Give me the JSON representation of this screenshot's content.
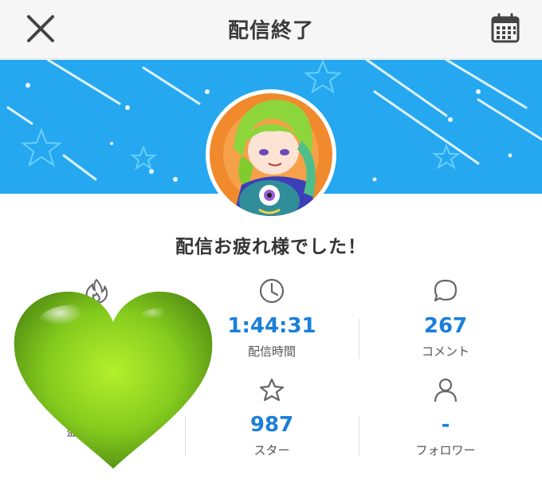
{
  "header": {
    "title": "配信終了"
  },
  "main": {
    "message": "配信お疲れ様でした！"
  },
  "stats": [
    {
      "icon": "flame-icon",
      "value": "",
      "label": "盛り上がり"
    },
    {
      "icon": "clock-icon",
      "value": "1:44:31",
      "label": "配信時間"
    },
    {
      "icon": "comment-icon",
      "value": "267",
      "label": "コメント"
    },
    {
      "icon": "star-icon",
      "value": "",
      "label": ""
    },
    {
      "icon": "star-icon",
      "value": "987",
      "label": "スター"
    },
    {
      "icon": "person-icon",
      "value": "-",
      "label": "フォロワー"
    }
  ],
  "colors": {
    "banner": "#26a8f0",
    "accent_value": "#1a7fd9",
    "heart": "#8cd21e"
  }
}
